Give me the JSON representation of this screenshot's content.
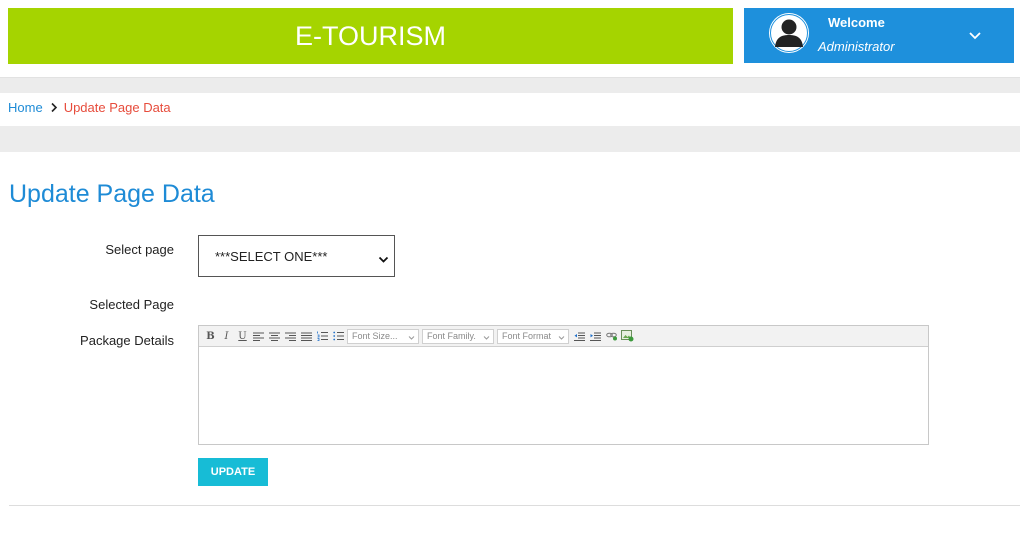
{
  "header": {
    "brand": "E-TOURISM",
    "welcome": "Welcome",
    "role": "Administrator",
    "colors": {
      "brand_bg": "#a5d400",
      "user_bg": "#1e90dc"
    }
  },
  "breadcrumb": {
    "home": "Home",
    "current": "Update Page Data"
  },
  "page_title": "Update Page Data",
  "form": {
    "select_page_label": "Select page",
    "select_page_value": "***SELECT ONE***",
    "selected_page_label": "Selected Page",
    "package_details_label": "Package Details",
    "toolbar": {
      "font_size": "Font Size...",
      "font_family": "Font Family.",
      "font_format": "Font Format"
    },
    "update_button": "UPDATE"
  }
}
